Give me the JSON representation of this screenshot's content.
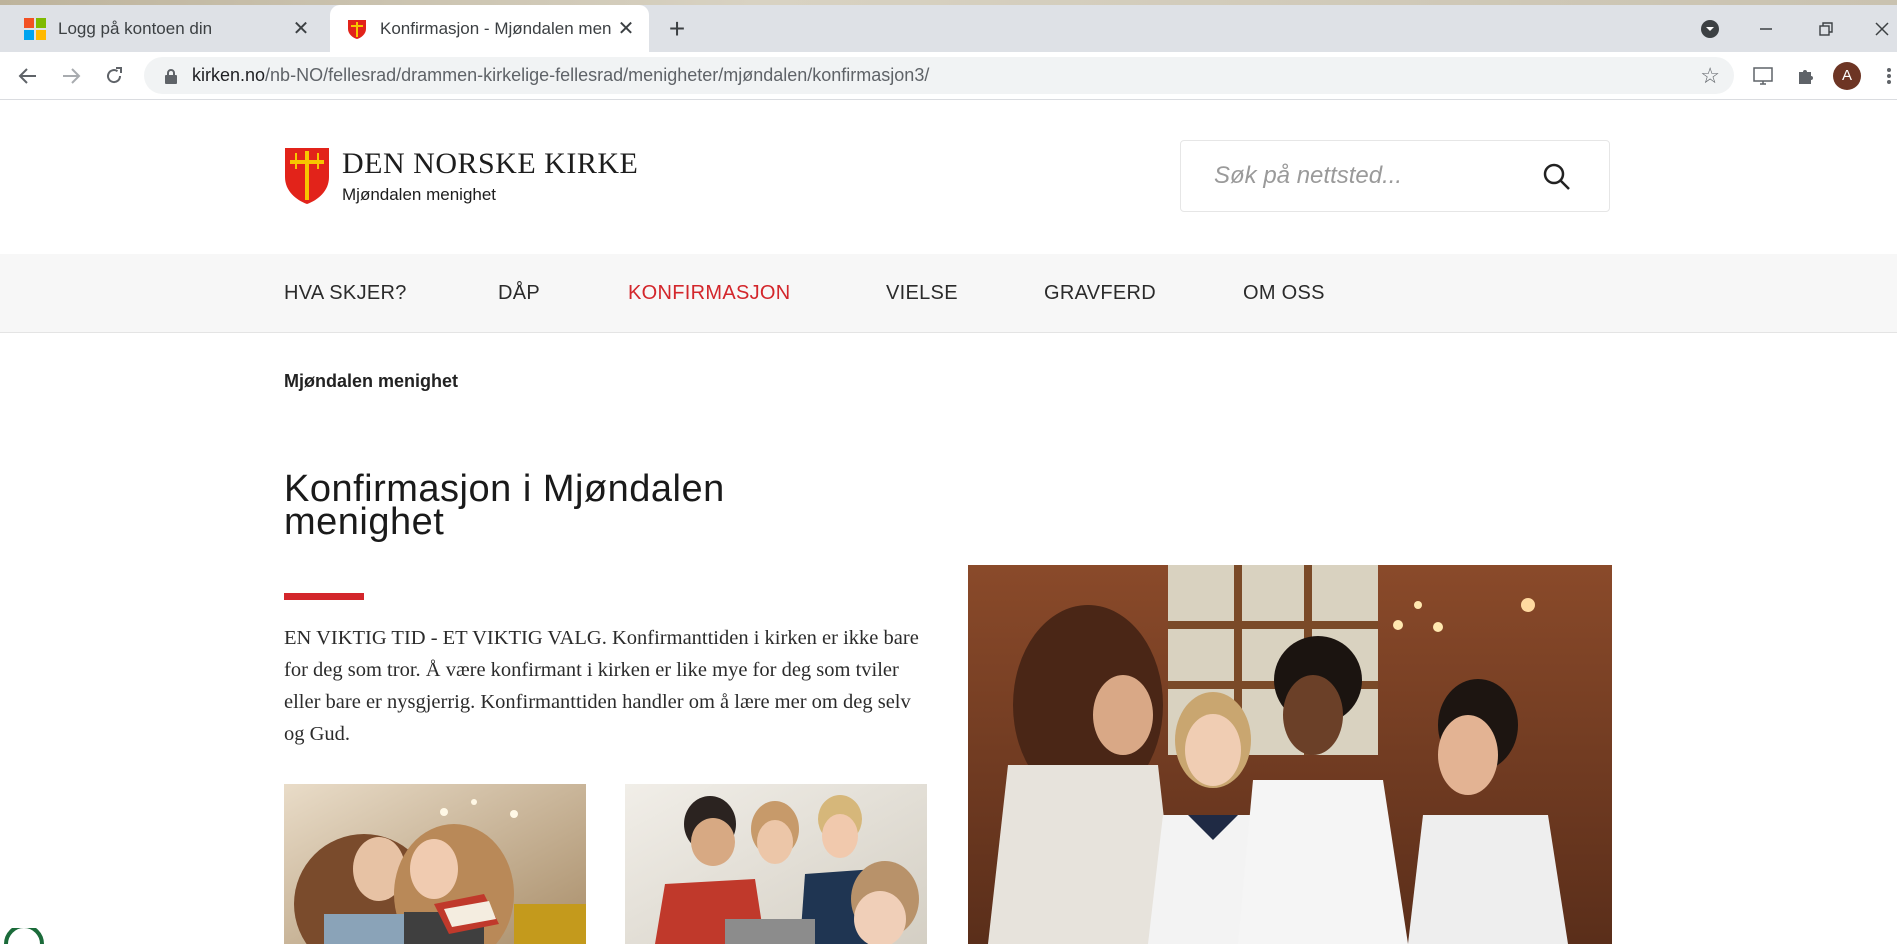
{
  "browser": {
    "tabs": [
      {
        "title": "Logg på kontoen din",
        "active": false,
        "icon": "microsoft-icon"
      },
      {
        "title": "Konfirmasjon - Mjøndalen menig",
        "active": true,
        "icon": "kirke-shield-icon"
      }
    ],
    "new_tab_symbol": "+",
    "close_symbol": "✕",
    "url_domain": "kirken.no",
    "url_path": "/nb-NO/fellesrad/drammen-kirkelige-fellesrad/menigheter/mjøndalen/konfirmasjon3/",
    "profile_initial": "A"
  },
  "site": {
    "org_name": "DEN NORSKE KIRKE",
    "parish_name": "Mjøndalen menighet",
    "search_placeholder": "Søk på nettsted..."
  },
  "nav": {
    "items": [
      {
        "label": "HVA SKJER?",
        "active": false
      },
      {
        "label": "DÅP",
        "active": false
      },
      {
        "label": "KONFIRMASJON",
        "active": true
      },
      {
        "label": "VIELSE",
        "active": false
      },
      {
        "label": "GRAVFERD",
        "active": false
      },
      {
        "label": "OM OSS",
        "active": false
      }
    ]
  },
  "breadcrumb": "Mjøndalen menighet",
  "content": {
    "heading": "Konfirmasjon i Mjøndalen menighet",
    "lead": "EN VIKTIG TID - ET VIKTIG VALG. Konfirmanttiden i kirken er ikke bare for deg som tror. Å være konfirmant i kirken er like mye for deg som tviler eller bare er nysgjerrig. Konfirmanttiden handler om å lære mer om deg selv og Gud."
  },
  "colors": {
    "accent": "#d3262b",
    "tabstrip": "#dee1e6",
    "nav_bg": "#f7f7f7"
  }
}
